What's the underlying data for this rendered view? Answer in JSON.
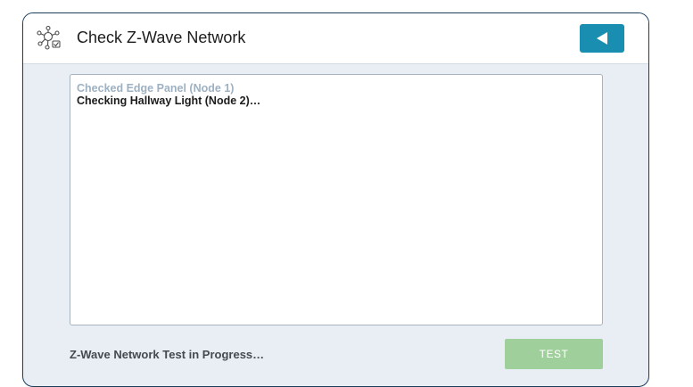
{
  "header": {
    "title": "Check Z-Wave Network",
    "icon": "network-check-icon",
    "back_icon": "back-arrow-icon",
    "accent_color": "#1a8eb0"
  },
  "log": {
    "lines": [
      {
        "text": "Checked Edge Panel (Node 1)",
        "state": "done"
      },
      {
        "text": "Checking Hallway Light (Node 2)…",
        "state": "active"
      }
    ]
  },
  "footer": {
    "status": "Z-Wave Network Test in Progress…",
    "test_label": "TEST",
    "test_color": "#9fd09c"
  }
}
